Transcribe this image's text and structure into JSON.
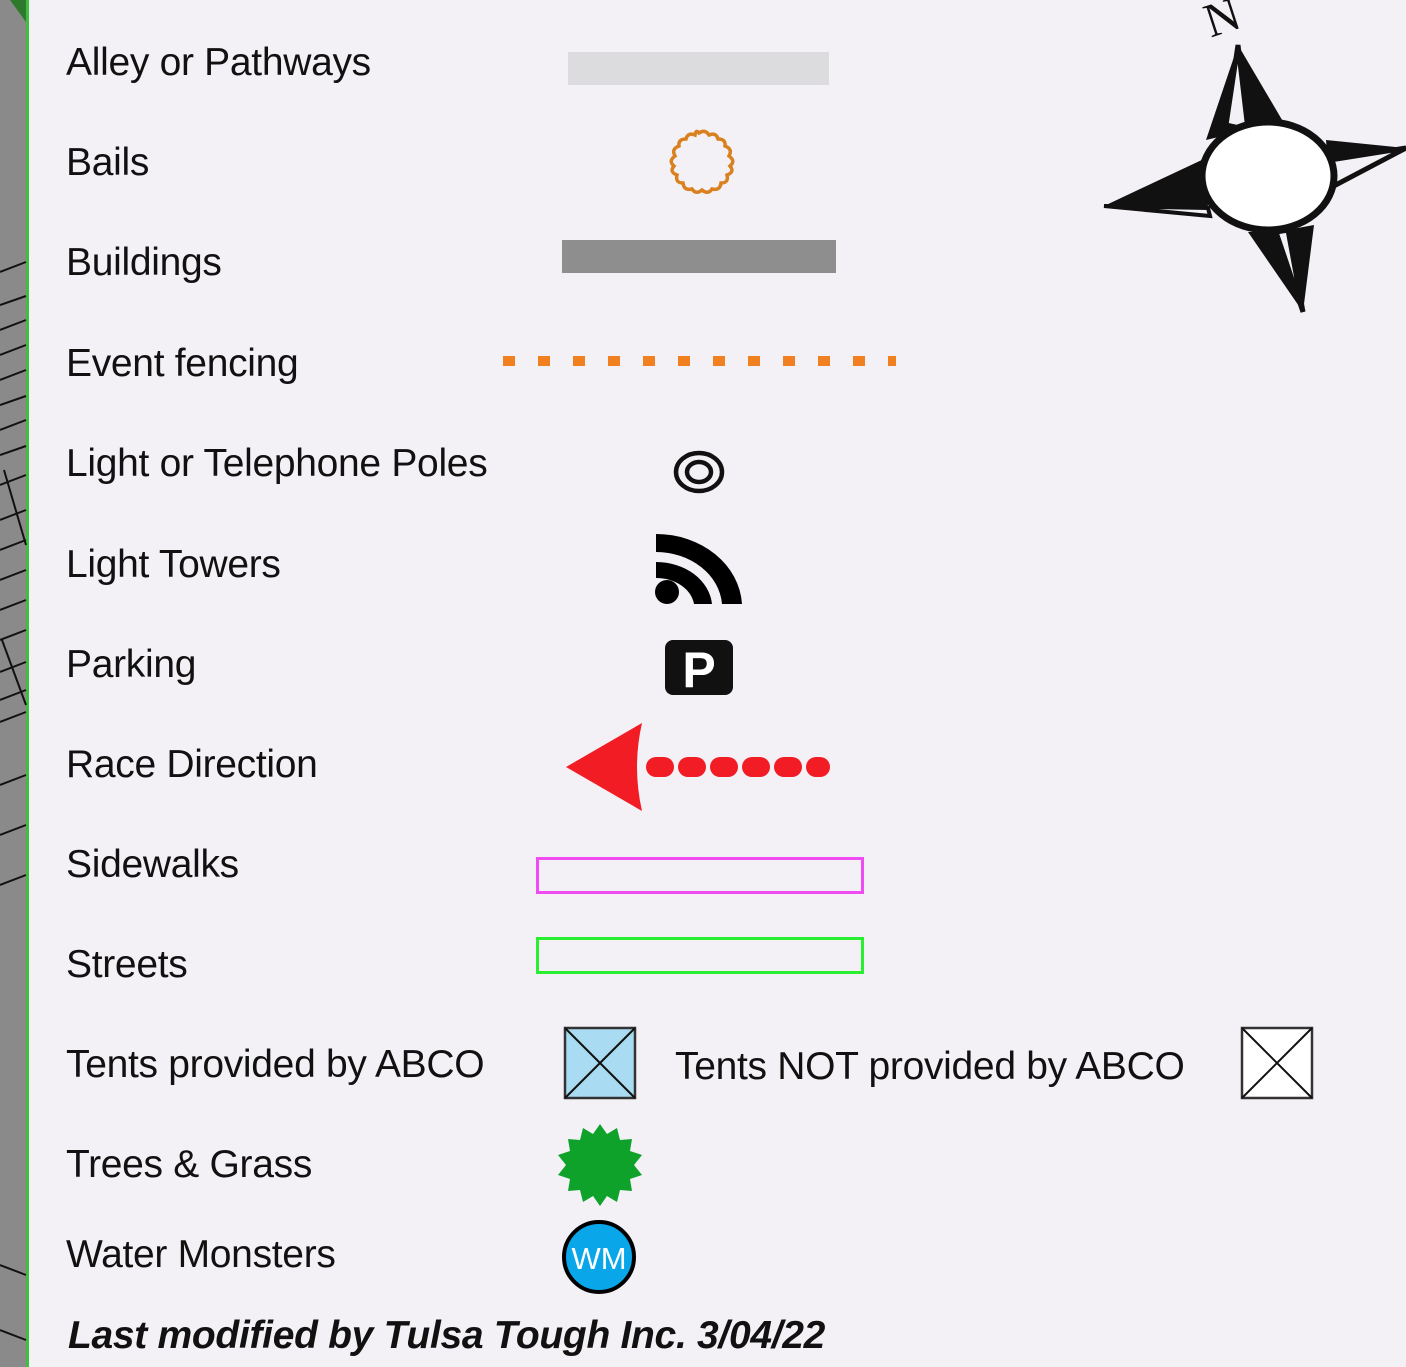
{
  "legend": {
    "items": [
      {
        "label": "Alley or Pathways",
        "symbol": "alley-swatch",
        "color": "#dcdcde"
      },
      {
        "label": "Bails",
        "symbol": "bail-icon",
        "color": "#d9801f"
      },
      {
        "label": "Buildings",
        "symbol": "building-swatch",
        "color": "#8e8e8e"
      },
      {
        "label": "Event fencing",
        "symbol": "fence-line",
        "color": "#f08020"
      },
      {
        "label": "Light or Telephone Poles",
        "symbol": "pole-icon",
        "color": "#111111"
      },
      {
        "label": "Light Towers",
        "symbol": "light-tower-icon",
        "color": "#000000"
      },
      {
        "label": "Parking",
        "symbol": "parking-icon",
        "color": "#111111"
      },
      {
        "label": "Race Direction",
        "symbol": "race-direction-arrow",
        "color": "#f21d24"
      },
      {
        "label": "Sidewalks",
        "symbol": "sidewalk-swatch",
        "color": "#f04cf4"
      },
      {
        "label": "Streets",
        "symbol": "street-swatch",
        "color": "#28f030"
      },
      {
        "label": "Tents provided by ABCO",
        "symbol": "abco-tent-icon",
        "color": "#a9dcf2"
      },
      {
        "label": "Trees & Grass",
        "symbol": "tree-icon",
        "color": "#0fa22a"
      },
      {
        "label": "Water Monsters",
        "symbol": "water-monster-icon",
        "color": "#0aa6ea"
      }
    ],
    "tents_not_abco_label": "Tents NOT provided by ABCO",
    "parking_letter": "P",
    "water_monster_abbrev": "WM"
  },
  "compass": {
    "north_letter": "N"
  },
  "footer": "Last modified by Tulsa Tough Inc. 3/04/22"
}
